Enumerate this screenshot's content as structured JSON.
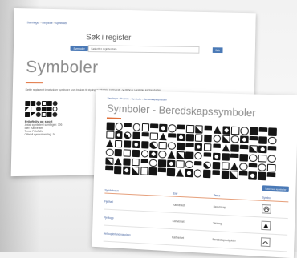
{
  "back_page": {
    "breadcrumb": [
      "Samlinger",
      "Registre",
      "Symboler"
    ],
    "search": {
      "title": "Søk i register",
      "filter_label": "Symboler",
      "placeholder": "Søk etter registerdata",
      "button_label": "Søk"
    },
    "title": "Symboler",
    "intro": "Dette registeret inneholder symboler som brukes til styling av digitale kartografi, og til bruk i grafiske kartprodukter.",
    "card": {
      "title": "Friluftsliv og sport",
      "lines": [
        "Antall symboler i samlingen: 106",
        "Eier: Kartverket",
        "Tema: Friluftsliv",
        "Offisiell symbolsamling: Ja"
      ]
    }
  },
  "front_page": {
    "breadcrumb": "Samlinger › Registre › Symboler › Beredskapssymboler",
    "title": "Symboler - Beredskapssymboler",
    "download_button": "Last ned symboler",
    "table": {
      "headers": [
        "Symbolnavn",
        "Eier",
        "Tema",
        "Symbol"
      ],
      "rows": [
        {
          "name": "Fjellhall",
          "owner": "Kartverket",
          "theme": "Beredskap",
          "symbol": "shelter-symbol-icon"
        },
        {
          "name": "Fjelltopp",
          "owner": "Kartverket",
          "theme": "Terreng",
          "symbol": "mountain-peak-symbol-icon"
        },
        {
          "name": "Helikopterlandingsplass",
          "owner": "Kartverket",
          "theme": "Beredskapsobjekter",
          "symbol": "helipad-symbol-icon"
        }
      ]
    }
  },
  "colors": {
    "accent_orange": "#e0703a",
    "link_blue": "#3a5a9a",
    "button_blue": "#4a79b6"
  }
}
